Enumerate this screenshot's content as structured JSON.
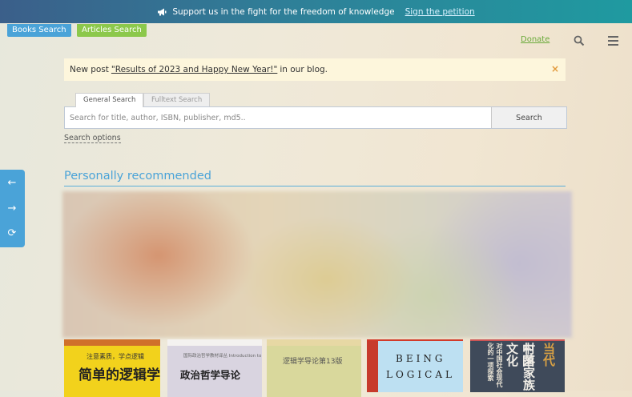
{
  "topbar": {
    "message": "Support us in the fight for the freedom of knowledge",
    "link": "Sign the petition",
    "icon": "megaphone-icon"
  },
  "tabs": {
    "books": "Books Search",
    "articles": "Articles Search"
  },
  "header": {
    "donate": "Donate",
    "search_icon": "search-icon",
    "menu_icon": "hamburger-menu-icon"
  },
  "notice": {
    "prefix": "New post",
    "link": "\"Results of 2023 and Happy New Year!\"",
    "suffix": "in our blog.",
    "close": "×"
  },
  "search": {
    "tabs": [
      "General Search",
      "Fulltext Search"
    ],
    "placeholder": "Search for title, author, ISBN, publisher, md5..",
    "button": "Search",
    "options": "Search options"
  },
  "sidebar": {
    "prev": "←",
    "next": "→",
    "refresh": "⟳"
  },
  "recommended": {
    "title": "Personally recommended",
    "books": [
      {
        "line1": "注意素质，学点逻辑",
        "line2": "简单的逻辑学"
      },
      {
        "line1": "国际政治哲学教材译丛 Introduction to Political Philosophy",
        "line2": "政治哲学导论"
      },
      {
        "line1": "逻辑学导论第13版"
      },
      {
        "line1": "BEING",
        "line2": "LOGICAL"
      },
      {
        "c1": "当代",
        "c2": "中国",
        "c3": "村落家族文化",
        "c4": "对中国社会现代化的一项探索"
      }
    ]
  },
  "colors": {
    "accent": "#4aa3d8",
    "green": "#8cc84b",
    "notice_bg": "#fdf6dc"
  }
}
